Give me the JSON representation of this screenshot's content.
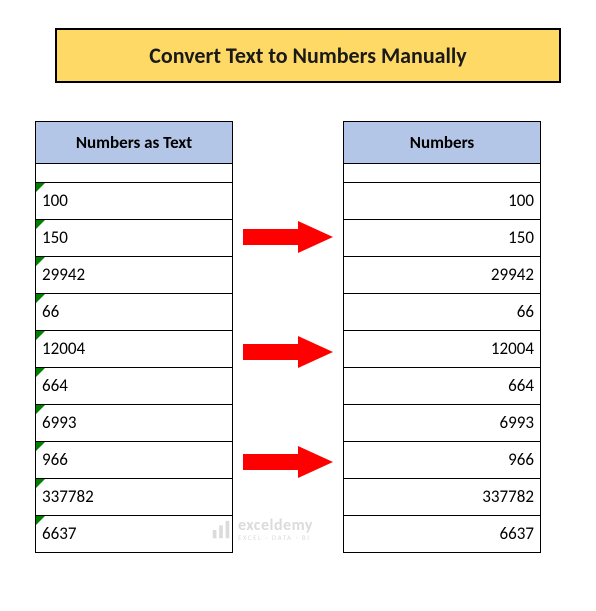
{
  "title": "Convert Text to Numbers Manually",
  "left_header": "Numbers as Text",
  "right_header": "Numbers",
  "values": [
    "100",
    "150",
    "29942",
    "66",
    "12004",
    "664",
    "6993",
    "966",
    "337782",
    "6637"
  ],
  "watermark": {
    "main": "exceldemy",
    "sub": "EXCEL · DATA · BI"
  },
  "chart_data": {
    "type": "table",
    "title": "Convert Text to Numbers Manually",
    "columns": [
      "Numbers as Text",
      "Numbers"
    ],
    "rows": [
      [
        "100",
        100
      ],
      [
        "150",
        150
      ],
      [
        "29942",
        29942
      ],
      [
        "66",
        66
      ],
      [
        "12004",
        12004
      ],
      [
        "664",
        664
      ],
      [
        "6993",
        6993
      ],
      [
        "966",
        966
      ],
      [
        "337782",
        337782
      ],
      [
        "6637",
        6637
      ]
    ]
  }
}
